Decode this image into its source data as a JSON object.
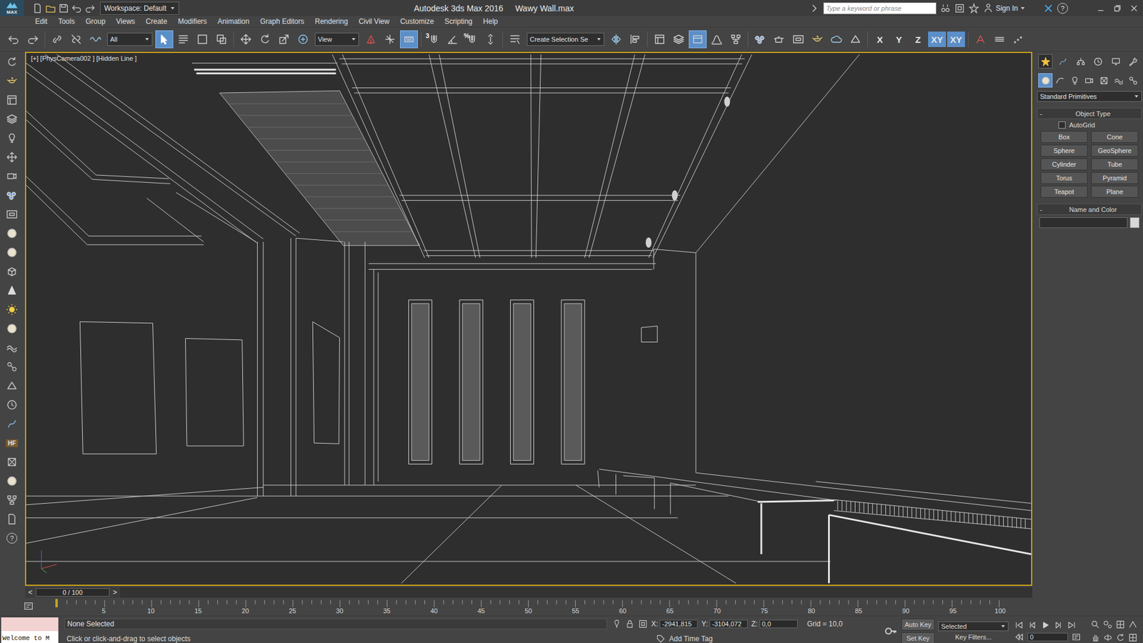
{
  "title_bar": {
    "logo": "MAX",
    "workspace": "Workspace: Default",
    "app_title": "Autodesk 3ds Max 2016",
    "file_name": "Wawy Wall.max",
    "search_placeholder": "Type a keyword or phrase",
    "sign_in": "Sign In",
    "help": "?"
  },
  "menu": [
    "Edit",
    "Tools",
    "Group",
    "Views",
    "Create",
    "Modifiers",
    "Animation",
    "Graph Editors",
    "Rendering",
    "Civil View",
    "Customize",
    "Scripting",
    "Help"
  ],
  "toolbar": {
    "selection_filter": "All",
    "reference_coordinate_system": "View",
    "named_selection_set": "Create Selection Se",
    "snap_label": "3",
    "percent_snap_label": "%",
    "select_object_active": true,
    "keyboard_override_active": true,
    "ribbon_active": true,
    "axis_constraints": [
      {
        "label": "X",
        "selected": false
      },
      {
        "label": "Y",
        "selected": false
      },
      {
        "label": "Z",
        "selected": false
      },
      {
        "label": "XY",
        "selected": true
      },
      {
        "label": "XY",
        "selected": true
      }
    ]
  },
  "left_toolbar": {
    "hf_label": "HF",
    "help": "?"
  },
  "viewport": {
    "label": "[+] [PhysCamera002 ] [Hidden Line ]",
    "active": true
  },
  "command_panel": {
    "tabs": [
      {
        "selected": true
      },
      {
        "selected": false
      },
      {
        "selected": false
      },
      {
        "selected": false
      },
      {
        "selected": false
      },
      {
        "selected": false
      }
    ],
    "categories": [
      {
        "selected": true
      },
      {
        "selected": false
      },
      {
        "selected": false
      },
      {
        "selected": false
      },
      {
        "selected": false
      },
      {
        "selected": false
      },
      {
        "selected": false
      }
    ],
    "object_class": "Standard Primitives",
    "object_type": {
      "toggle": "-",
      "title": "Object Type",
      "autogrid": {
        "label": "AutoGrid",
        "checked": false
      },
      "buttons": [
        "Box",
        "Cone",
        "Sphere",
        "GeoSphere",
        "Cylinder",
        "Tube",
        "Torus",
        "Pyramid",
        "Teapot",
        "Plane"
      ]
    },
    "name_and_color": {
      "toggle": "-",
      "title": "Name and Color",
      "name": "",
      "swatch_color": "#d8d8d8"
    }
  },
  "timeline": {
    "prev": "<",
    "slider": "0 / 100",
    "next": ">",
    "level": 0,
    "ticks": [
      "5",
      "10",
      "15",
      "20",
      "25",
      "30",
      "35",
      "40",
      "45",
      "50",
      "55",
      "60",
      "65",
      "70",
      "75",
      "80",
      "85",
      "90",
      "95",
      "100"
    ]
  },
  "status_bar": {
    "listener": "Welcome to M",
    "selection": "None Selected",
    "prompt": "Click or click-and-drag to select objects",
    "coords": [
      {
        "label": "X:",
        "value": "-2941,815"
      },
      {
        "label": "Y:",
        "value": "-3104,072"
      },
      {
        "label": "Z:",
        "value": "0,0"
      }
    ],
    "grid": "Grid = 10,0",
    "add_time_tag": "Add Time Tag",
    "auto_key": "Auto Key",
    "auto_key_active": false,
    "key_set": "Selected",
    "set_key": "Set Key",
    "key_filters": "Key Filters...",
    "current_frame": "0"
  }
}
